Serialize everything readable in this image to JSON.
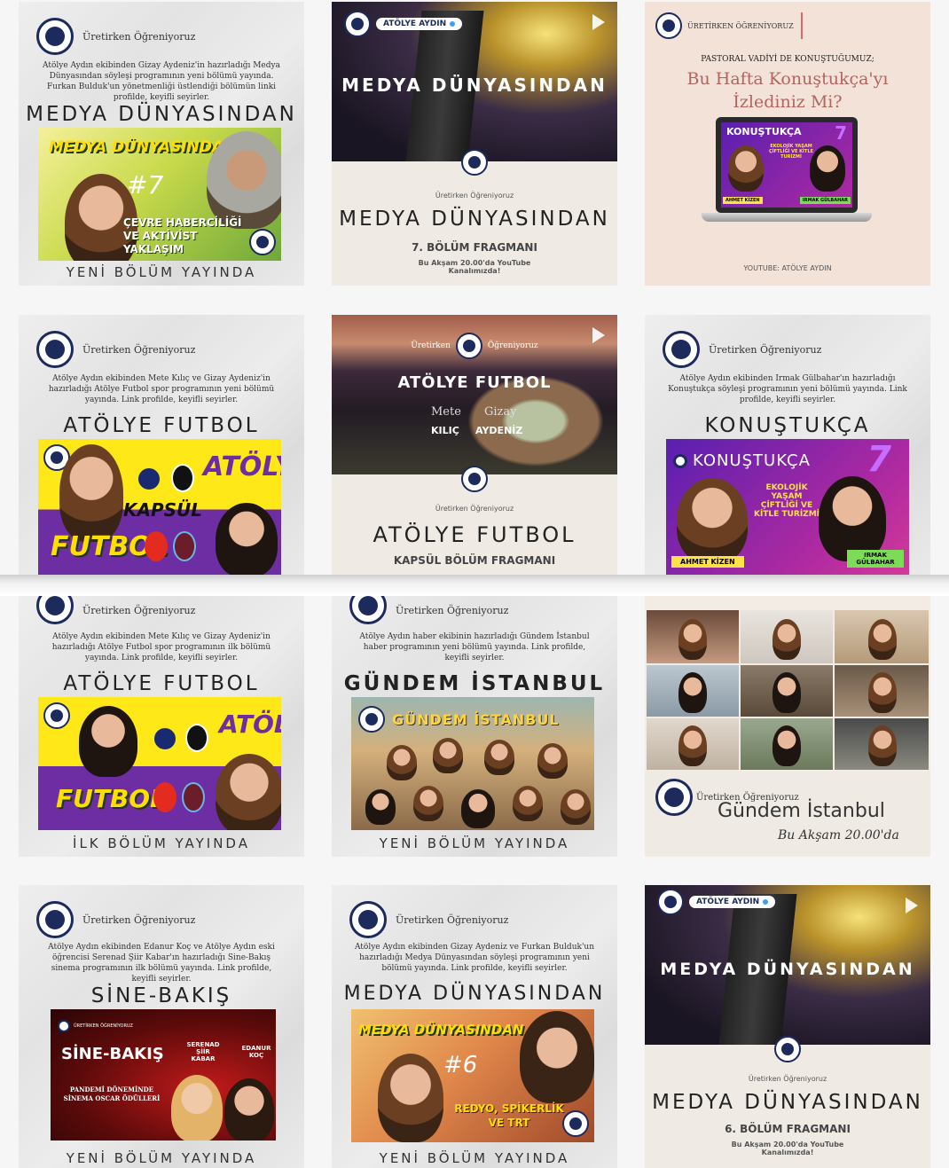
{
  "brand": "Üretirken Öğreniyoruz",
  "posts": {
    "p1": {
      "desc": "Atölye Aydın ekibinden Gizay Aydeniz'in hazırladığı Medya Dünyasından söyleşi programının yeni bölümü yayında. Furkan Bulduk'un yönetmenliği üstlendiği bölümün linki profilde, keyifli seyirler.",
      "title": "MEDYA DÜNYASINDAN",
      "banner_title": "MEDYA DÜNYASINDAN",
      "banner_num": "#7",
      "banner_sub": "ÇEVRE HABERCİLİĞİ VE AKTİVİST YAKLAŞIM",
      "footer": "YENİ BÖLÜM YAYINDA"
    },
    "p2": {
      "chip": "ATÖLYE AYDIN",
      "hero": "MEDYA DÜNYASINDAN",
      "brand": "Üretirken Öğreniyoruz",
      "title": "MEDYA DÜNYASINDAN",
      "sub": "7. BÖLÜM FRAGMANI",
      "note": "Bu Akşam 20.00'da YouTube Kanalımızda!"
    },
    "p3": {
      "brand": "ÜRETİRKEN ÖĞRENİYORUZ",
      "kicker": "PASTORAL VADİYİ DE KONUŞTUĞUMUZ;",
      "headline": "Bu Hafta Konuştukça'yı İzlediniz Mi?",
      "screen_title": "KONUŞTUKÇA",
      "screen_num": "7",
      "screen_sub": "EKOLOJİK YAŞAM ÇİFTLİĞİ VE KİTLE TURİZMİ",
      "guest1": "AHMET KİZEN",
      "guest2": "IRMAK GÜLBAHAR",
      "footer": "YOUTUBE: ATÖLYE AYDIN"
    },
    "p4": {
      "desc": "Atölye Aydın ekibinden Mete Kılıç ve Gizay Aydeniz'in hazırladığı Atölye Futbol spor programının yeni bölümü yayında. Link profilde, keyifli seyirler.",
      "title": "ATÖLYE FUTBOL",
      "b1": "ATÖLYE",
      "b2": "KAPSÜL",
      "b3": "FUTBOL"
    },
    "p5": {
      "brand_left": "Üretirken",
      "brand_right": "Öğreniyoruz",
      "hero": "ATÖLYE FUTBOL",
      "n1": "Mete",
      "n2": "Gizay",
      "s1": "KILIÇ",
      "s2": "AYDENİZ",
      "brand": "Üretirken Öğreniyoruz",
      "title": "ATÖLYE FUTBOL",
      "sub": "KAPSÜL BÖLÜM FRAGMANI"
    },
    "p6": {
      "desc": "Atölye Aydın ekibinden Irmak Gülbahar'ın hazırladığı Konuştukça söyleşi programının yeni bölümü yayında. Link profilde, keyifli seyirler.",
      "title": "KONUŞTUKÇA",
      "banner_title": "KONUŞTUKÇA",
      "banner_num": "7",
      "banner_sub": "EKOLOJİK YAŞAM ÇİFTLİĞİ VE KİTLE TURİZMİ",
      "guest1": "AHMET KİZEN",
      "guest2": "IRMAK GÜLBAHAR"
    },
    "p7": {
      "desc": "Atölye Aydın ekibinden Mete Kılıç ve Gizay Aydeniz'in hazırladığı Atölye Futbol spor programının ilk bölümü yayında. Link profilde, keyifli seyirler.",
      "title": "ATÖLYE FUTBOL",
      "b1": "ATÖLYE",
      "b3": "FUTBOL",
      "footer": "İLK BÖLÜM YAYINDA"
    },
    "p8": {
      "desc": "Atölye Aydın haber ekibinin hazırladığı Gündem İstanbul haber programının yeni bölümü yayında. Link profilde, keyifli seyirler.",
      "title": "GÜNDEM İSTANBUL",
      "banner_title": "GÜNDEM İSTANBUL",
      "footer": "YENİ BÖLÜM YAYINDA"
    },
    "p9": {
      "brand": "Üretirken Öğreniyoruz",
      "title": "Gündem İstanbul",
      "script": "Bu Akşam 20.00'da"
    },
    "p10": {
      "desc": "Atölye Aydın ekibinden Edanur Koç ve Atölye Aydın eski öğrencisi Serenad Şiir Kabar'ın hazırladığı Sine-Bakış sinema programının ilk bölümü yayında. Link profilde, keyifli seyirler.",
      "title": "SİNE-BAKIŞ",
      "banner_brand": "ÜRETİRKEN ÖĞRENİYORUZ",
      "banner_title": "SİNE-BAKIŞ",
      "guest1": "SERENAD ŞİİR KABAR",
      "guest2": "EDANUR KOÇ",
      "banner_sub": "PANDEMİ DÖNEMİNDE SİNEMA OSCAR ÖDÜLLERİ",
      "footer": "YENİ BÖLÜM YAYINDA"
    },
    "p11": {
      "desc": "Atölye Aydın ekibinden Gizay Aydeniz ve Furkan Bulduk'un hazırladığı Medya Dünyasından söyleşi programının yeni bölümü yayında. Link profilde, keyifli seyirler.",
      "title": "MEDYA DÜNYASINDAN",
      "banner_title": "MEDYA DÜNYASINDAN",
      "banner_num": "#6",
      "banner_sub": "REDYO, SPİKERLİK VE TRT",
      "footer": "YENİ BÖLÜM YAYINDA"
    },
    "p12": {
      "chip": "ATÖLYE AYDIN",
      "hero": "MEDYA DÜNYASINDAN",
      "brand": "Üretirken Öğreniyoruz",
      "title": "MEDYA DÜNYASINDAN",
      "sub": "6. BÖLÜM FRAGMANI",
      "note": "Bu Akşam 20.00'da YouTube Kanalımızda!"
    }
  },
  "colors": {
    "navy": "#1d2a5c",
    "yellow": "#ffde00",
    "purple": "#6d2ea3",
    "konus_purple": "#7a2ac0"
  }
}
